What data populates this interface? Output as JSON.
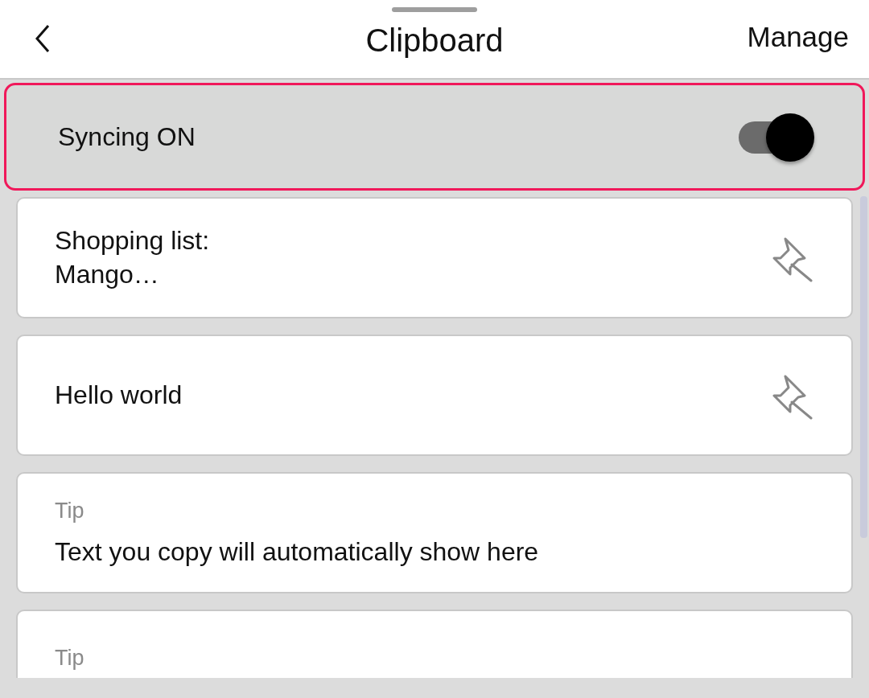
{
  "header": {
    "title": "Clipboard",
    "action": "Manage"
  },
  "sync": {
    "label": "Syncing ON",
    "on": true
  },
  "items": [
    {
      "kind": "clip",
      "text": "Shopping list:\nMango…"
    },
    {
      "kind": "clip",
      "text": "Hello world"
    },
    {
      "kind": "tip",
      "label": "Tip",
      "text": "Text you copy will automatically show here"
    },
    {
      "kind": "tip",
      "label": "Tip"
    }
  ]
}
